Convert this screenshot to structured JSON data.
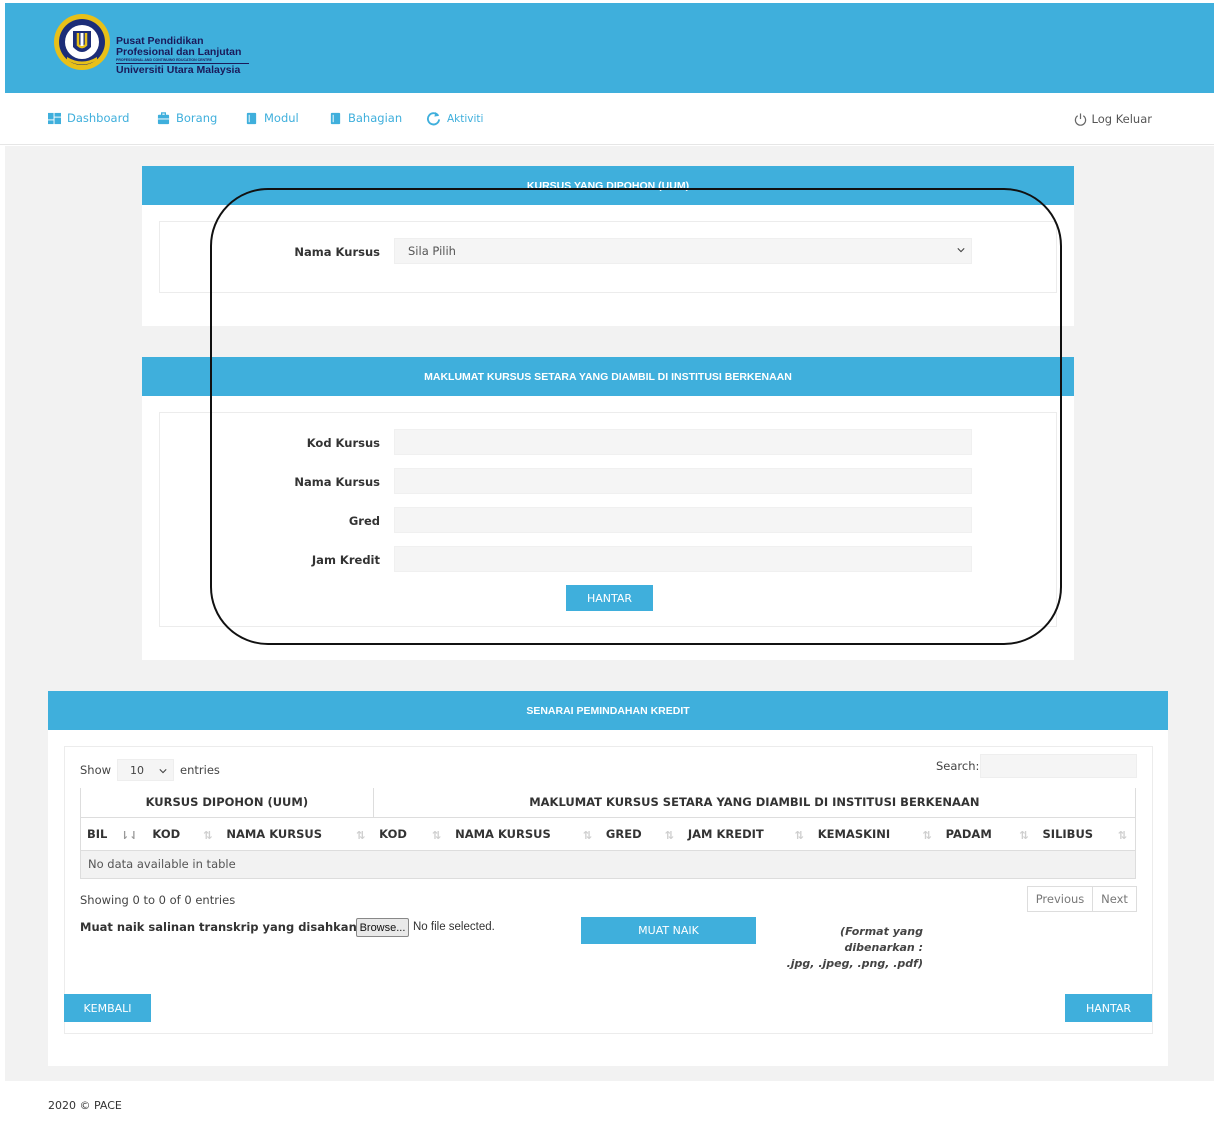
{
  "header": {
    "logo_line1": "Pusat Pendidikan",
    "logo_line2": "Profesional dan Lanjutan",
    "logo_line3": "PROFESSIONAL AND CONTINUING EDUCATION CENTRE",
    "logo_line4": "Universiti Utara Malaysia",
    "accent_color": "#3fafdc"
  },
  "nav": {
    "items": [
      {
        "label": "Dashboard",
        "icon": "dashboard-icon"
      },
      {
        "label": "Borang",
        "icon": "briefcase-icon"
      },
      {
        "label": "Modul",
        "icon": "book-icon"
      },
      {
        "label": "Bahagian",
        "icon": "book-icon"
      },
      {
        "label": "Aktiviti",
        "icon": "refresh-icon"
      }
    ],
    "logout_label": "Log Keluar",
    "logout_icon": "power-icon"
  },
  "panel1": {
    "title": "KURSUS YANG DIPOHON (UUM)",
    "course_label": "Nama Kursus",
    "course_select_value": "Sila Pilih"
  },
  "panel2": {
    "title": "MAKLUMAT KURSUS SETARA YANG DIAMBIL DI INSTITUSI BERKENAAN",
    "code_label": "Kod Kursus",
    "name_label": "Nama Kursus",
    "grade_label": "Gred",
    "credit_label": "Jam Kredit",
    "submit_label": "HANTAR"
  },
  "panel3": {
    "title": "SENARAI PEMINDAHAN KREDIT",
    "show_label": "Show",
    "entries_value": "10",
    "entries_label": "entries",
    "search_label": "Search:",
    "group_left": "KURSUS DIPOHON (UUM)",
    "group_right": "MAKLUMAT KURSUS SETARA YANG DIAMBIL DI INSTITUSI BERKENAAN",
    "columns": [
      "BIL",
      "KOD",
      "NAMA KURSUS",
      "KOD",
      "NAMA KURSUS",
      "GRED",
      "JAM KREDIT",
      "KEMASKINI",
      "PADAM",
      "SILIBUS"
    ],
    "empty_text": "No data available in table",
    "showing_text": "Showing 0 to 0 of 0 entries",
    "prev_label": "Previous",
    "next_label": "Next",
    "upload_label": "Muat naik salinan transkrip yang disahkan",
    "browse_label": "Browse...",
    "no_file_text": "No file selected.",
    "upload_button": "MUAT NAIK",
    "format_line1": "(Format yang dibenarkan :",
    "format_line2": ".jpg, .jpeg, .png, .pdf)",
    "back_button": "KEMBALI",
    "submit_button": "HANTAR"
  },
  "footer": {
    "text": "2020 © PACE"
  }
}
